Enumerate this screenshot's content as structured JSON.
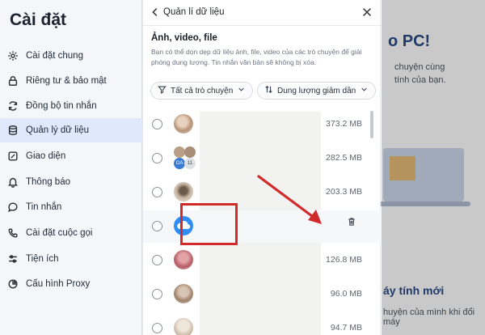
{
  "sidebar": {
    "title": "Cài đặt",
    "items": [
      {
        "label": "Cài đặt chung",
        "icon": "gear-icon"
      },
      {
        "label": "Riêng tư & bảo mật",
        "icon": "lock-icon"
      },
      {
        "label": "Đồng bộ tin nhắn",
        "icon": "sync-icon"
      },
      {
        "label": "Quản lý dữ liệu",
        "icon": "database-icon",
        "active": true
      },
      {
        "label": "Giao diện",
        "icon": "palette-icon"
      },
      {
        "label": "Thông báo",
        "icon": "bell-icon"
      },
      {
        "label": "Tin nhắn",
        "icon": "chat-bubble-icon"
      },
      {
        "label": "Cài đặt cuộc gọi",
        "icon": "phone-icon"
      },
      {
        "label": "Tiện ích",
        "icon": "sliders-icon"
      },
      {
        "label": "Cấu hình Proxy",
        "icon": "proxy-icon"
      }
    ]
  },
  "background": {
    "heading_fragment": "o PC!",
    "line1": "chuyện cùng",
    "line2": "tính của bạn.",
    "subheading_fragment": "áy tính mới",
    "footer_line": "huyện của mình khi đổi máy"
  },
  "panel": {
    "title": "Quản lí dữ liệu",
    "section_title": "Ảnh, video, file",
    "description": "Bạn có thể dọn dẹp dữ liệu ảnh, file, video của các trò chuyện để giải phóng dung lượng. Tin nhắn văn bản sẽ không bị xóa.",
    "filter_chats": "Tất cả trò chuyện",
    "filter_sort": "Dung lượng giảm dần",
    "rows": [
      {
        "size": "373.2 MB"
      },
      {
        "size": "282.5 MB"
      },
      {
        "size": "203.3 MB"
      },
      {
        "size": ""
      },
      {
        "size": "126.8 MB"
      },
      {
        "size": "96.0 MB"
      },
      {
        "size": "94.7 MB"
      }
    ],
    "group_badge": "11"
  },
  "colors": {
    "accent_active": "#dfe9fb",
    "highlight_red": "#d12b2b",
    "cloud_blue": "#2f8df5"
  }
}
